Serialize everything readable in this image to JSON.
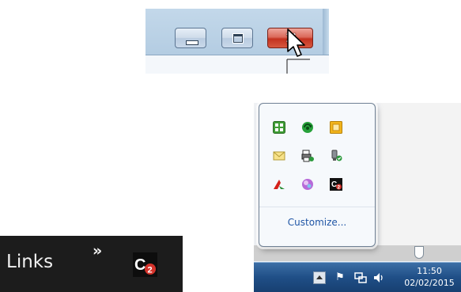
{
  "caption_buttons": {
    "minimize_icon": "minimize-icon",
    "maximize_icon": "maximize-icon",
    "close_glyph": "✕",
    "close_color": "#c3321f"
  },
  "notification_area": {
    "hidden_icons": [
      {
        "name": "green-grid-app-icon"
      },
      {
        "name": "green-recycle-icon"
      },
      {
        "name": "orange-square-app-icon"
      },
      {
        "name": "mail-envelope-icon"
      },
      {
        "name": "printer-sync-icon"
      },
      {
        "name": "usb-safely-remove-icon"
      },
      {
        "name": "red-arrow-logo-icon"
      },
      {
        "name": "purple-bubble-icon"
      },
      {
        "name": "c2-app-icon"
      }
    ],
    "customize_link": "Customize...",
    "clock_time": "11:50",
    "clock_date": "02/02/2015",
    "accent_color": "#1f55a5",
    "taskbar_color": "#1f4e86"
  },
  "links_toolbar": {
    "label": "Links",
    "overflow_chevron": "»",
    "app_icon": "c2-app-icon"
  }
}
